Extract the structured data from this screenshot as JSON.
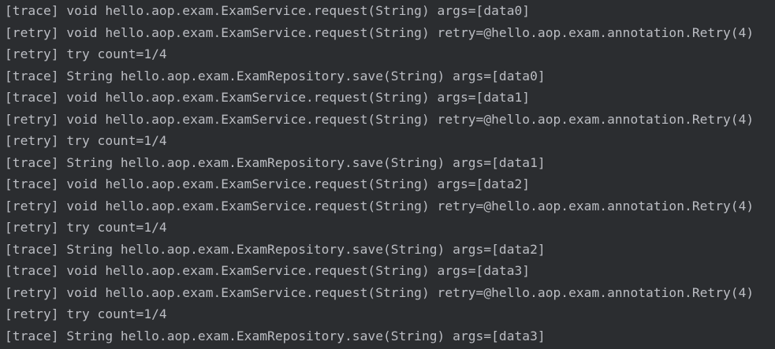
{
  "console": {
    "lines": [
      "[trace] void hello.aop.exam.ExamService.request(String) args=[data0]",
      "[retry] void hello.aop.exam.ExamService.request(String) retry=@hello.aop.exam.annotation.Retry(4)",
      "[retry] try count=1/4",
      "[trace] String hello.aop.exam.ExamRepository.save(String) args=[data0]",
      "[trace] void hello.aop.exam.ExamService.request(String) args=[data1]",
      "[retry] void hello.aop.exam.ExamService.request(String) retry=@hello.aop.exam.annotation.Retry(4)",
      "[retry] try count=1/4",
      "[trace] String hello.aop.exam.ExamRepository.save(String) args=[data1]",
      "[trace] void hello.aop.exam.ExamService.request(String) args=[data2]",
      "[retry] void hello.aop.exam.ExamService.request(String) retry=@hello.aop.exam.annotation.Retry(4)",
      "[retry] try count=1/4",
      "[trace] String hello.aop.exam.ExamRepository.save(String) args=[data2]",
      "[trace] void hello.aop.exam.ExamService.request(String) args=[data3]",
      "[retry] void hello.aop.exam.ExamService.request(String) retry=@hello.aop.exam.annotation.Retry(4)",
      "[retry] try count=1/4",
      "[trace] String hello.aop.exam.ExamRepository.save(String) args=[data3]"
    ]
  },
  "colors": {
    "background": "#2b2d30",
    "text": "#bcbec4"
  }
}
